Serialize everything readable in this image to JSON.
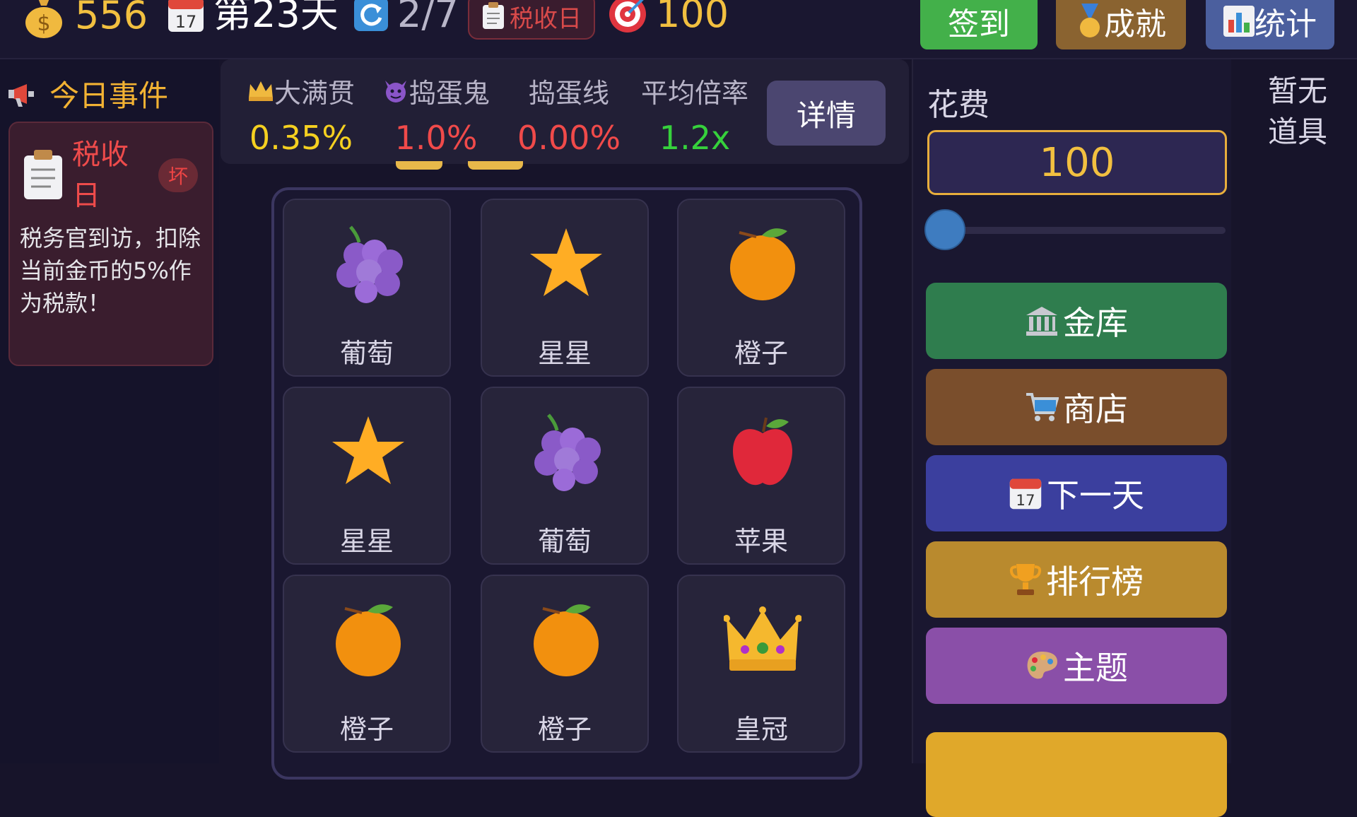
{
  "topbar": {
    "coins": "556",
    "day": "第23天",
    "spins": "2/7",
    "event_tag": "税收日",
    "target": "100",
    "buttons": {
      "checkin": "签到",
      "achievement": "成就",
      "stats": "统计"
    }
  },
  "event": {
    "section_title": "今日事件",
    "name": "税收日",
    "badge": "坏",
    "description": "税务官到访，扣除当前金币的5%作为税款！"
  },
  "stats": {
    "jackpot": {
      "label": "大满贯",
      "value": "0.35%"
    },
    "troll": {
      "label": "捣蛋鬼",
      "value": "1.0%"
    },
    "trollline": {
      "label": "捣蛋线",
      "value": "0.00%"
    },
    "multiplier": {
      "label": "平均倍率",
      "value": "1.2x"
    },
    "detail_button": "详情"
  },
  "grid": [
    {
      "name": "葡萄",
      "icon": "grape-icon"
    },
    {
      "name": "星星",
      "icon": "star-icon"
    },
    {
      "name": "橙子",
      "icon": "orange-icon"
    },
    {
      "name": "星星",
      "icon": "star-icon"
    },
    {
      "name": "葡萄",
      "icon": "grape-icon"
    },
    {
      "name": "苹果",
      "icon": "apple-icon"
    },
    {
      "name": "橙子",
      "icon": "orange-icon"
    },
    {
      "name": "橙子",
      "icon": "orange-icon"
    },
    {
      "name": "皇冠",
      "icon": "crown-icon"
    }
  ],
  "bet": {
    "label": "花费",
    "value": "100",
    "slider_level": 0
  },
  "actions": {
    "vault": "金库",
    "shop": "商店",
    "next_day": "下一天",
    "leaderboard": "排行榜",
    "theme": "主题"
  },
  "props": {
    "empty": "暂无道具"
  },
  "colors": {
    "background": "#17142a",
    "gold": "#f2c040",
    "yellow_value": "#f5d020",
    "red_value": "#f04a4a",
    "green_value": "#36d13c",
    "checkin": "#43b04a",
    "achievement": "#8a6330",
    "stats_button": "#4b5f9e",
    "vault": "#2f7d4e",
    "shop": "#7a4e2c",
    "next_day": "#3b3f9e",
    "leaderboard": "#b98a2e",
    "theme": "#8a4fa8"
  }
}
